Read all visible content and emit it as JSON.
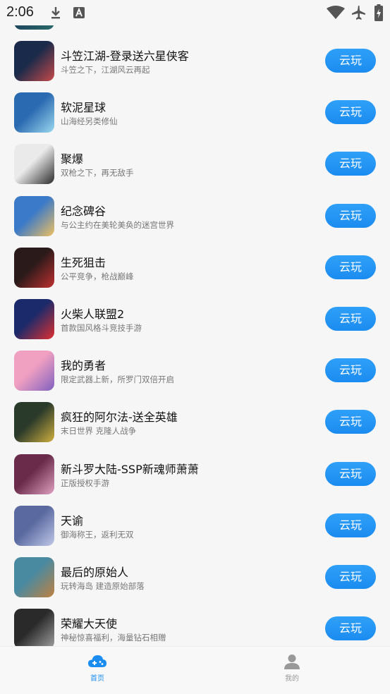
{
  "status_bar": {
    "time": "2:06"
  },
  "colors": {
    "accent": "#1b8cf0",
    "background": "#f6f6f7",
    "text": "#111111",
    "subtext": "#777777"
  },
  "games": [
    {
      "name": "斗笠江湖-登录送六星侠客",
      "desc": "斗笠之下，江湖风云再起",
      "button": "云玩",
      "icon_colors": [
        "#1a2a4a",
        "#c84a4a"
      ]
    },
    {
      "name": "软泥星球",
      "desc": "山海经另类修仙",
      "button": "云玩",
      "icon_colors": [
        "#2a6ab0",
        "#9cd8f0"
      ]
    },
    {
      "name": "聚爆",
      "desc": "双枪之下，再无敌手",
      "button": "云玩",
      "icon_colors": [
        "#eaeaea",
        "#2a2a2a"
      ]
    },
    {
      "name": "纪念碑谷",
      "desc": "与公主约在美轮美奂的迷宫世界",
      "button": "云玩",
      "icon_colors": [
        "#3a7ac8",
        "#f0c060"
      ]
    },
    {
      "name": "生死狙击",
      "desc": "公平竞争，枪战巅峰",
      "button": "云玩",
      "icon_colors": [
        "#2a1a1a",
        "#c03030"
      ]
    },
    {
      "name": "火柴人联盟2",
      "desc": "首款国风格斗竞技手游",
      "button": "云玩",
      "icon_colors": [
        "#1a2a6a",
        "#e03030"
      ]
    },
    {
      "name": "我的勇者",
      "desc": "限定武器上新，所罗门双倍开启",
      "button": "云玩",
      "icon_colors": [
        "#f0a0c0",
        "#8060c0"
      ]
    },
    {
      "name": "疯狂的阿尔法-送全英雄",
      "desc": "末日世界 克隆人战争",
      "button": "云玩",
      "icon_colors": [
        "#2a3a2a",
        "#d0b040"
      ]
    },
    {
      "name": "新斗罗大陆-SSP新魂师萧萧",
      "desc": "正版授权手游",
      "button": "云玩",
      "icon_colors": [
        "#6a2a4a",
        "#e0a0c0"
      ]
    },
    {
      "name": "天谕",
      "desc": "御海称王，返利无双",
      "button": "云玩",
      "icon_colors": [
        "#5a6aa0",
        "#c0c8e8"
      ]
    },
    {
      "name": "最后的原始人",
      "desc": "玩转海岛 建造原始部落",
      "button": "云玩",
      "icon_colors": [
        "#4a8aa0",
        "#c08040"
      ]
    },
    {
      "name": "荣耀大天使",
      "desc": "神秘惊喜福利，海量钻石相赠",
      "button": "云玩",
      "icon_colors": [
        "#2a2a2a",
        "#a0a0a0"
      ]
    }
  ],
  "tabbar": {
    "home": {
      "label": "首页",
      "icon": "cloud-gamepad-icon"
    },
    "mine": {
      "label": "我的",
      "icon": "person-icon"
    }
  }
}
